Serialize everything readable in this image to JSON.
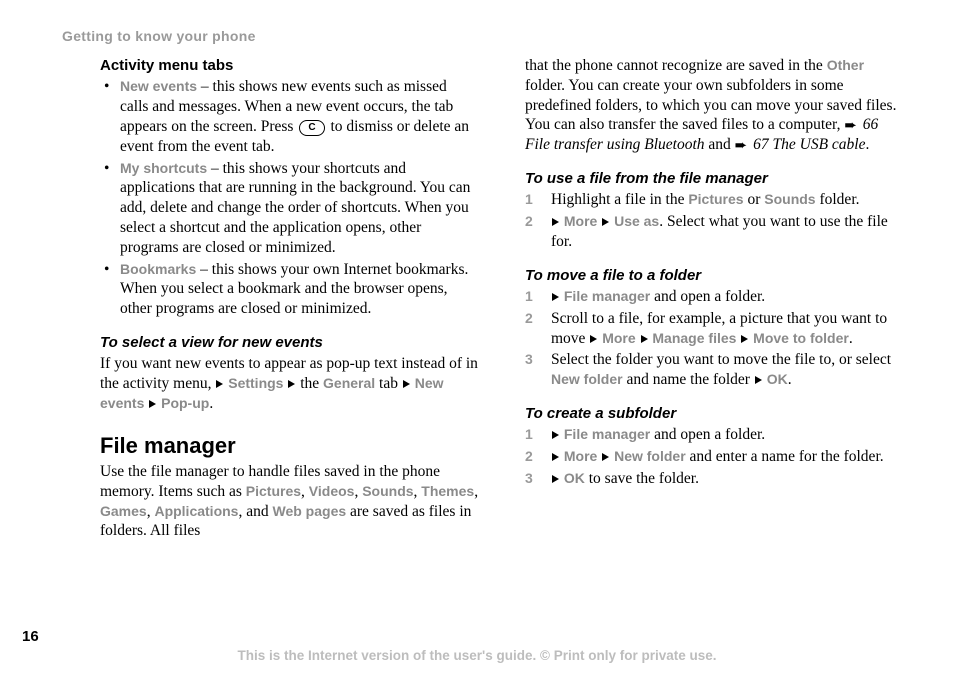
{
  "chapter": "Getting to know your phone",
  "page_number": "16",
  "footer": "This is the Internet version of the user's guide. © Print only for private use.",
  "ui": {
    "new_events": "New events",
    "my_shortcuts": "My shortcuts",
    "bookmarks": "Bookmarks",
    "settings": "Settings",
    "general": "General",
    "pop_up": "Pop-up",
    "pictures": "Pictures",
    "videos": "Videos",
    "sounds": "Sounds",
    "themes": "Themes",
    "games": "Games",
    "applications": "Applications",
    "web_pages": "Web pages",
    "other": "Other",
    "more": "More",
    "use_as": "Use as",
    "file_manager": "File manager",
    "manage_files": "Manage files",
    "move_to_folder": "Move to folder",
    "new_folder": "New folder",
    "ok": "OK"
  },
  "key": {
    "c": "C"
  },
  "col1": {
    "h_tabs": "Activity menu tabs",
    "b1a": " – this shows new events such as missed calls and messages. When a new event occurs, the tab appears on the screen. Press ",
    "b1b": " to dismiss or delete an event from the event tab.",
    "b2": " – this shows your shortcuts and applications that are running in the background. You can add, delete and change the order of shortcuts. When you select a shortcut and the application opens, other programs are closed or minimized.",
    "b3": " – this shows your own Internet bookmarks. When you select a bookmark and the browser opens, other programs are closed or minimized.",
    "h_select": "To select a view for new events",
    "sel_a": "If you want new events to appear as pop-up text instead of in the activity menu, ",
    "sel_b": " the ",
    "sel_c": " tab ",
    "h_fm": "File manager",
    "fm_a": "Use the file manager to handle files saved in the phone memory. Items such as ",
    "fm_b": ", and ",
    "fm_c": " are saved as files in folders. All files "
  },
  "col2": {
    "top_a": "that the phone cannot recognize are saved in the ",
    "top_b": " folder. You can create your own subfolders in some predefined folders, to which you can move your saved files. You can also transfer the saved files to a computer, ",
    "ref1": "66 File transfer using Bluetooth",
    "top_c": " and ",
    "ref2": "67 The USB cable",
    "h_use": "To use a file from the file manager",
    "use_s1a": "Highlight a file in the ",
    "use_s1b": " or ",
    "use_s1c": " folder.",
    "use_s2": ". Select what you want to use the file for.",
    "h_move": "To move a file to a folder",
    "mv_s1": " and open a folder.",
    "mv_s2a": "Scroll to a file, for example, a picture that you want to move ",
    "mv_s3a": "Select the folder you want to move the file to, or select ",
    "mv_s3b": " and name the folder ",
    "h_create": "To create a subfolder",
    "cr_s1": " and open a folder.",
    "cr_s2": " and enter a name for the folder.",
    "cr_s3": " to save the folder."
  }
}
